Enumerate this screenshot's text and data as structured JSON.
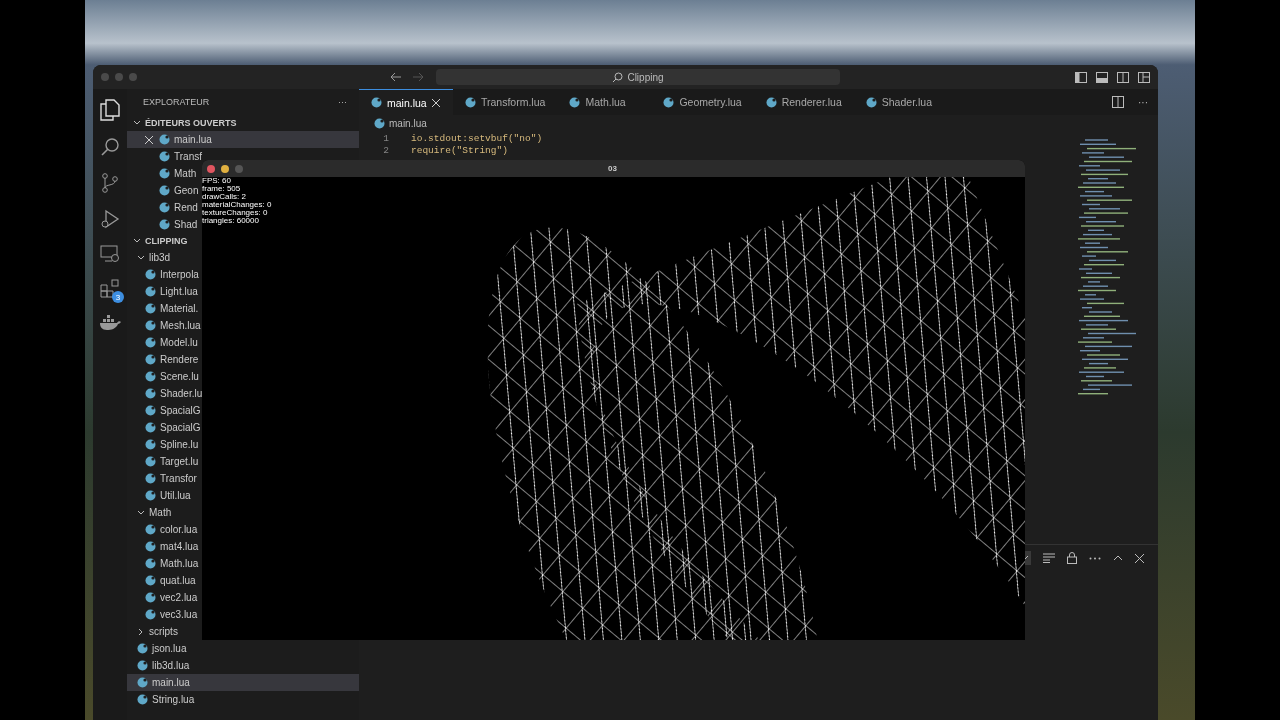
{
  "window": {
    "search": "Clipping"
  },
  "activity_bar": {
    "extensions_badge": "3"
  },
  "sidebar": {
    "title": "EXPLORATEUR",
    "more": "···",
    "open_editors": {
      "title": "ÉDITEURS OUVERTS",
      "expanded": true,
      "items": [
        {
          "label": "main.lua",
          "selected": true
        },
        {
          "label": "Transf",
          "selected": false
        },
        {
          "label": "Math",
          "selected": false
        },
        {
          "label": "Geon",
          "selected": false
        },
        {
          "label": "Rend",
          "selected": false
        },
        {
          "label": "Shad",
          "selected": false
        }
      ]
    },
    "project": {
      "title": "CLIPPING",
      "expanded": true,
      "children": [
        {
          "label": "lib3d",
          "kind": "folder",
          "expanded": true,
          "selected": false,
          "children": [
            {
              "label": "Interpola",
              "kind": "file",
              "selected": false
            },
            {
              "label": "Light.lua",
              "kind": "file",
              "selected": false
            },
            {
              "label": "Material.",
              "kind": "file",
              "selected": false
            },
            {
              "label": "Mesh.lua",
              "kind": "file",
              "selected": false
            },
            {
              "label": "Model.lu",
              "kind": "file",
              "selected": false
            },
            {
              "label": "Rendere",
              "kind": "file",
              "selected": false
            },
            {
              "label": "Scene.lu",
              "kind": "file",
              "selected": false
            },
            {
              "label": "Shader.lu",
              "kind": "file",
              "selected": false
            },
            {
              "label": "SpacialG",
              "kind": "file",
              "selected": false
            },
            {
              "label": "SpacialG",
              "kind": "file",
              "selected": false
            },
            {
              "label": "Spline.lu",
              "kind": "file",
              "selected": false
            },
            {
              "label": "Target.lu",
              "kind": "file",
              "selected": false
            },
            {
              "label": "Transfor",
              "kind": "file",
              "selected": false
            },
            {
              "label": "Util.lua",
              "kind": "file",
              "selected": false
            }
          ]
        },
        {
          "label": "Math",
          "kind": "folder",
          "expanded": true,
          "selected": false,
          "children": [
            {
              "label": "color.lua",
              "kind": "file",
              "selected": false
            },
            {
              "label": "mat4.lua",
              "kind": "file",
              "selected": false
            },
            {
              "label": "Math.lua",
              "kind": "file",
              "selected": false
            },
            {
              "label": "quat.lua",
              "kind": "file",
              "selected": false
            },
            {
              "label": "vec2.lua",
              "kind": "file",
              "selected": false
            },
            {
              "label": "vec3.lua",
              "kind": "file",
              "selected": false
            }
          ]
        },
        {
          "label": "scripts",
          "kind": "folder",
          "expanded": false,
          "selected": false
        },
        {
          "label": "json.lua",
          "kind": "file",
          "selected": false
        },
        {
          "label": "lib3d.lua",
          "kind": "file",
          "selected": false
        },
        {
          "label": "main.lua",
          "kind": "file",
          "selected": true
        },
        {
          "label": "String.lua",
          "kind": "file",
          "selected": false
        }
      ]
    }
  },
  "tabs": [
    {
      "label": "main.lua",
      "selected": true
    },
    {
      "label": "Transform.lua",
      "selected": false
    },
    {
      "label": "Math.lua",
      "selected": false
    },
    {
      "label": "Geometry.lua",
      "selected": false
    },
    {
      "label": "Renderer.lua",
      "selected": false
    },
    {
      "label": "Shader.lua",
      "selected": false
    }
  ],
  "editor": {
    "breadcrumb": "main.lua",
    "lines": [
      {
        "number": "1",
        "code": "io.stdout:setvbuf(\"no\")"
      },
      {
        "number": "2",
        "code": "require(\"String\")"
      }
    ]
  },
  "app_window": {
    "title": "03",
    "stats": [
      "FPS: 60",
      "frame: 505",
      "drawCalls: 2",
      "materialChanges: 0",
      "textureChanges: 0",
      "triangles: 60000"
    ]
  }
}
